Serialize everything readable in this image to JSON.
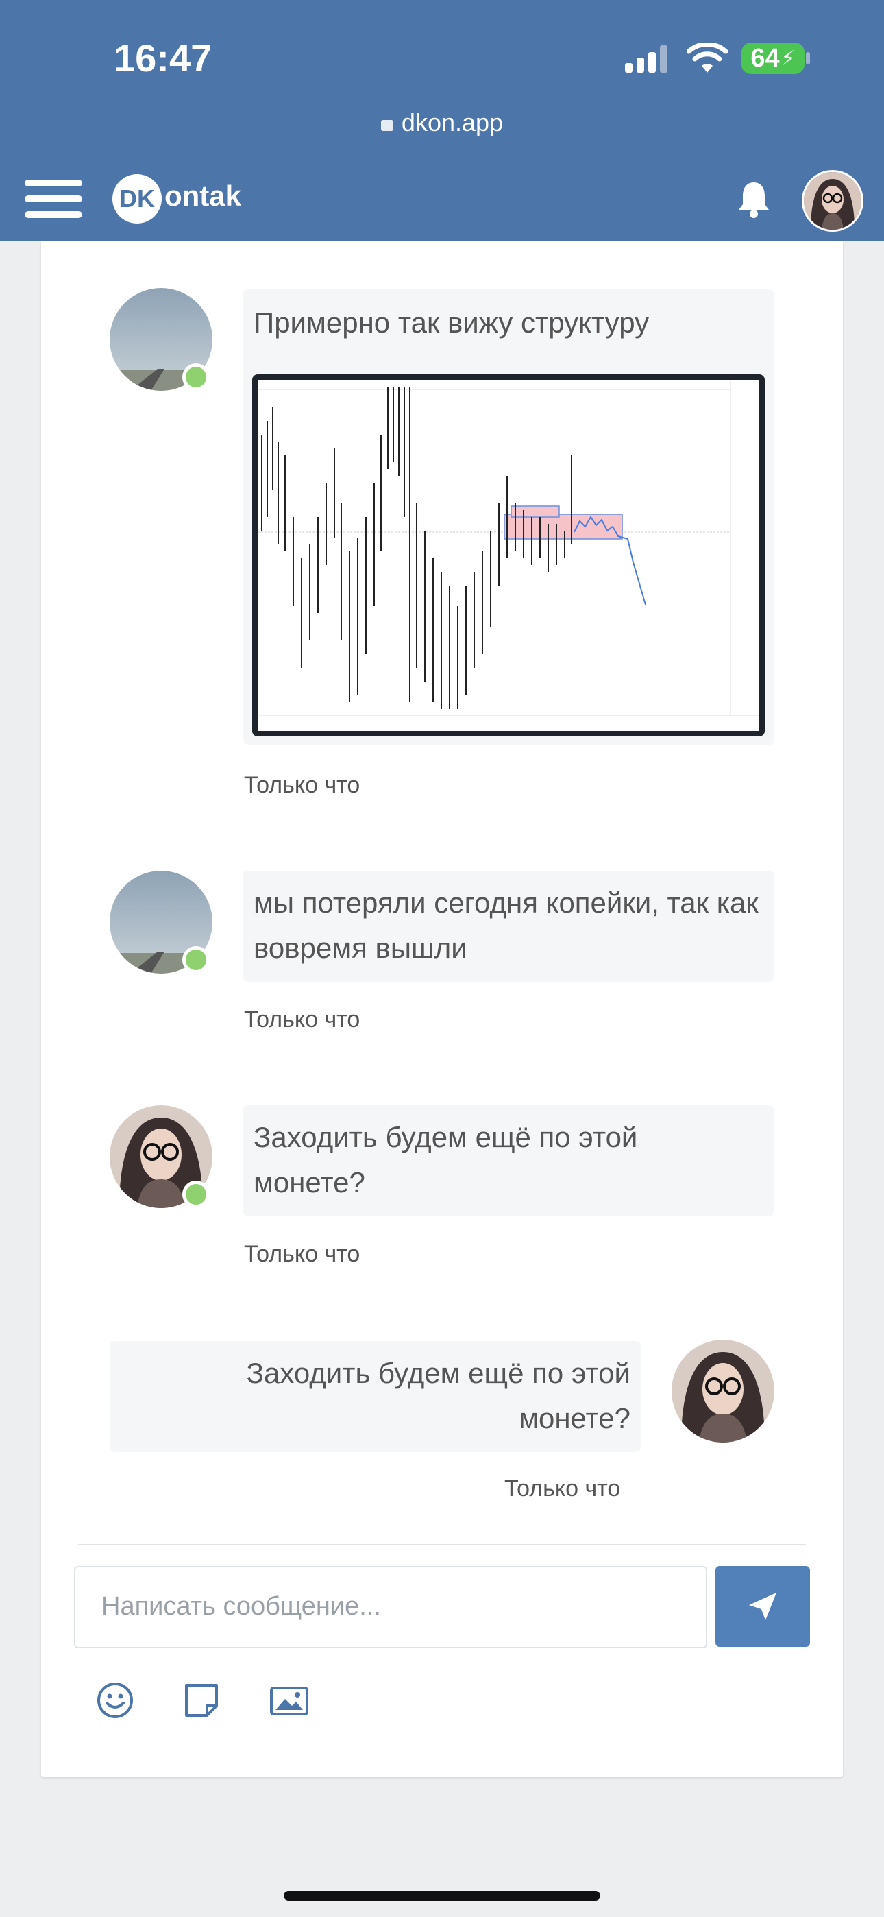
{
  "status_bar": {
    "time": "16:47",
    "battery": "64"
  },
  "browser": {
    "url": "dkon.app"
  },
  "header": {
    "logo_badge": "DK",
    "logo_text": "ontak"
  },
  "messages": [
    {
      "text": "Примерно так вижу структуру",
      "time": "Только что",
      "has_image": true,
      "image_desc": "chart-screenshot"
    },
    {
      "text": "мы потеряли сегодня копейки, так как вовремя вышли",
      "time": "Только что"
    },
    {
      "text": "Заходить будем ещё по этой монете?",
      "time": "Только что"
    },
    {
      "text": "Заходить будем ещё по этой монете?",
      "time": "Только что",
      "own": true
    }
  ],
  "composer": {
    "placeholder": "Написать сообщение..."
  },
  "colors": {
    "brand": "#4c75a9",
    "send_button": "#5181b8",
    "online": "#8fd16e",
    "bubble": "#f5f6f8"
  }
}
